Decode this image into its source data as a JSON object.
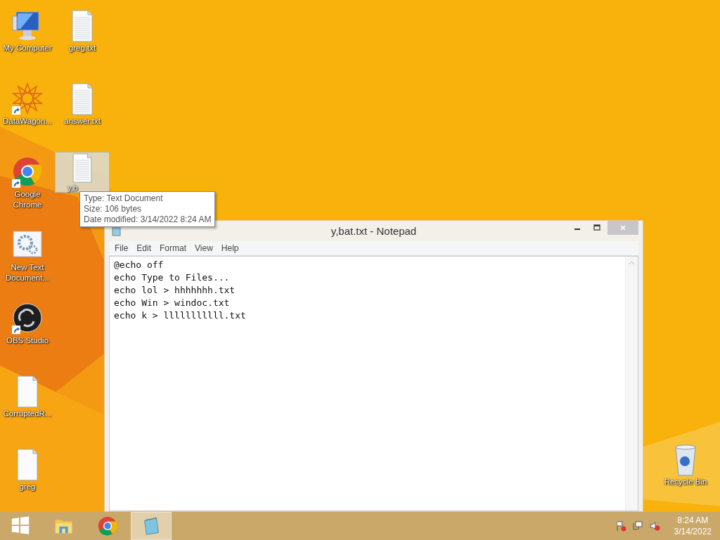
{
  "desktop_icons": [
    {
      "label": "My Computer",
      "kind": "computer",
      "shortcut": false,
      "selected": false
    },
    {
      "label": "DataWagon...",
      "kind": "star",
      "shortcut": true,
      "selected": false
    },
    {
      "label": "Google Chrome",
      "kind": "chrome",
      "shortcut": true,
      "selected": false
    },
    {
      "label": "New Text Document...",
      "kind": "gears",
      "shortcut": false,
      "selected": false
    },
    {
      "label": "OBS Studio",
      "kind": "obs",
      "shortcut": true,
      "selected": false
    },
    {
      "label": "CorruptedR...",
      "kind": "blank",
      "shortcut": false,
      "selected": false
    },
    {
      "label": "greg",
      "kind": "blank",
      "shortcut": false,
      "selected": false
    },
    {
      "label": "greg.txt",
      "kind": "text",
      "shortcut": false,
      "selected": false
    },
    {
      "label": "answer.txt",
      "kind": "text",
      "shortcut": false,
      "selected": false
    },
    {
      "label": "y,b",
      "kind": "text",
      "shortcut": false,
      "selected": true
    }
  ],
  "recycle_bin": {
    "label": "Recycle Bin"
  },
  "tooltip": {
    "lines": [
      "Type: Text Document",
      "Size: 106 bytes",
      "Date modified: 3/14/2022 8:24 AM"
    ]
  },
  "notepad": {
    "title": "y,bat.txt - Notepad",
    "menu": [
      "File",
      "Edit",
      "Format",
      "View",
      "Help"
    ],
    "lines": [
      "@echo off",
      "echo Type to Files...",
      "echo lol > hhhhhhh.txt",
      "echo Win > windoc.txt",
      "echo k > lllllllllll.txt"
    ]
  },
  "taskbar": {
    "buttons": [
      {
        "kind": "start",
        "active": false
      },
      {
        "kind": "explorer",
        "active": false
      },
      {
        "kind": "chrome",
        "active": false
      },
      {
        "kind": "notepad",
        "active": true
      }
    ],
    "time": "8:24 AM",
    "date": "3/14/2022"
  }
}
